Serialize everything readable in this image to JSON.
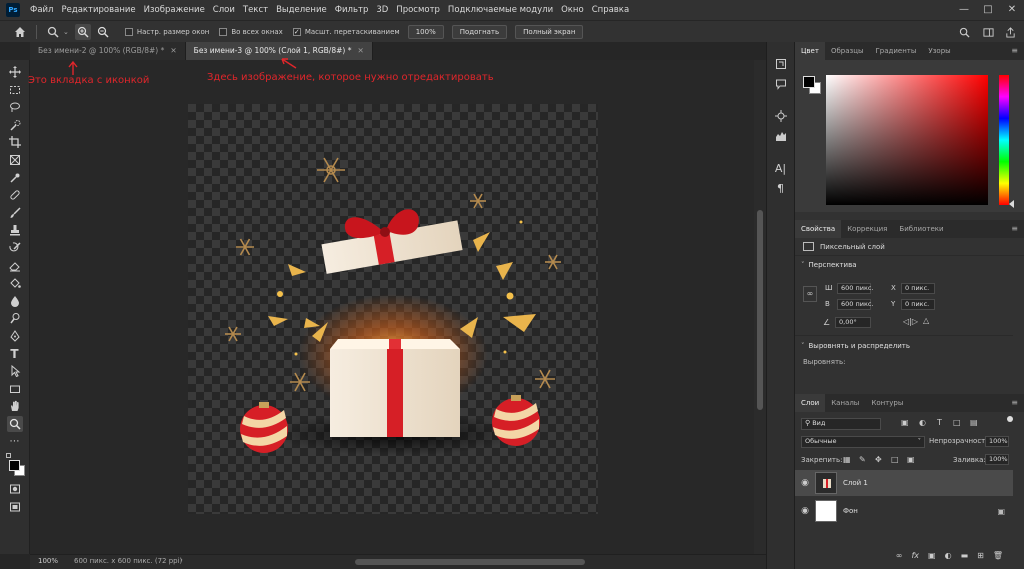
{
  "menu": {
    "logo": "Ps",
    "items": [
      "Файл",
      "Редактирование",
      "Изображение",
      "Слои",
      "Текст",
      "Выделение",
      "Фильтр",
      "3D",
      "Просмотр",
      "Подключаемые модули",
      "Окно",
      "Справка"
    ]
  },
  "options_bar": {
    "resize_windows": "Настр. размер окон",
    "all_windows": "Во всех окнах",
    "scrubby_zoom": "Масшт. перетаскиванием",
    "zoom_value": "100%",
    "fit_button": "Подогнать",
    "fullscreen_button": "Полный экран"
  },
  "tabs": [
    {
      "label": "Без имени-2 @ 100% (RGB/8#) *",
      "active": false
    },
    {
      "label": "Без имени-3 @ 100% (Слой 1, RGB/8#) *",
      "active": true
    }
  ],
  "annotations": {
    "tab_note": "Это вкладка с иконкой",
    "image_note": "Здесь изображение, котороe нужно отредактировать"
  },
  "status_bar": {
    "zoom": "100%",
    "doc_info": "600 пикс. x 600 пикс. (72 ppi)"
  },
  "color_panel": {
    "tabs": [
      "Цвет",
      "Образцы",
      "Градиенты",
      "Узоры"
    ],
    "picker_hue": "#ff0000"
  },
  "properties_panel": {
    "tabs": [
      "Свойства",
      "Коррекция",
      "Библиотеки"
    ],
    "layer_type": "Пиксельный слой",
    "transform_title": "Перспектива",
    "w_label": "Ш",
    "w_value": "600 пикс.",
    "h_label": "В",
    "h_value": "600 пикс.",
    "x_label": "X",
    "x_value": "0 пикс.",
    "y_label": "Y",
    "y_value": "0 пикс.",
    "angle_value": "0,00°",
    "align_title": "Выровнять и распределить",
    "align_label": "Выровнять:"
  },
  "layers_panel": {
    "tabs": [
      "Слои",
      "Каналы",
      "Контуры"
    ],
    "filter_kind": "Вид",
    "blend_mode": "Обычные",
    "opacity_label": "Непрозрачность:",
    "opacity_value": "100%",
    "lock_label": "Закрепить:",
    "fill_label": "Заливка:",
    "fill_value": "100%",
    "layers": [
      {
        "name": "Слой 1",
        "selected": true
      },
      {
        "name": "Фон",
        "selected": false
      }
    ]
  }
}
